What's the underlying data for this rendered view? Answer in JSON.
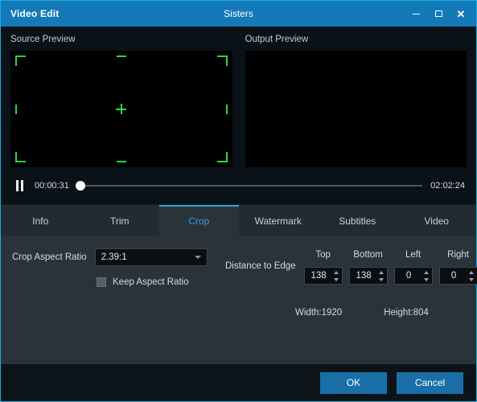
{
  "titlebar": {
    "app_name": "Video Edit",
    "document_title": "Sisters",
    "minimize_icon": "minimize-icon",
    "maximize_icon": "maximize-icon",
    "close_icon": "close-icon",
    "close_glyph": "✕",
    "background_color": "#1479b8"
  },
  "previews": {
    "source_label": "Source Preview",
    "output_label": "Output Preview",
    "crop_handle_color": "#2fd34a"
  },
  "transport": {
    "play_state_icon": "pause-icon",
    "current_time": "00:00:31",
    "total_time": "02:02:24",
    "progress_percent": 0.4
  },
  "tabs": [
    {
      "label": "Info",
      "active": false
    },
    {
      "label": "Trim",
      "active": false
    },
    {
      "label": "Crop",
      "active": true
    },
    {
      "label": "Watermark",
      "active": false
    },
    {
      "label": "Subtitles",
      "active": false
    },
    {
      "label": "Video",
      "active": false
    }
  ],
  "crop_panel": {
    "aspect_ratio_label": "Crop Aspect Ratio",
    "aspect_ratio_value": "2.39:1",
    "aspect_ratio_options": [
      "2.39:1"
    ],
    "keep_aspect_ratio_label": "Keep Aspect Ratio",
    "keep_aspect_ratio_checked": false,
    "distance_to_edge_label": "Distance to Edge",
    "edges": [
      {
        "name": "Top",
        "value": "138"
      },
      {
        "name": "Bottom",
        "value": "138"
      },
      {
        "name": "Left",
        "value": "0"
      },
      {
        "name": "Right",
        "value": "0"
      }
    ],
    "width_text": "Width:1920",
    "height_text": "Height:804"
  },
  "footer": {
    "ok_label": "OK",
    "cancel_label": "Cancel",
    "button_color": "#1a6fa8"
  }
}
